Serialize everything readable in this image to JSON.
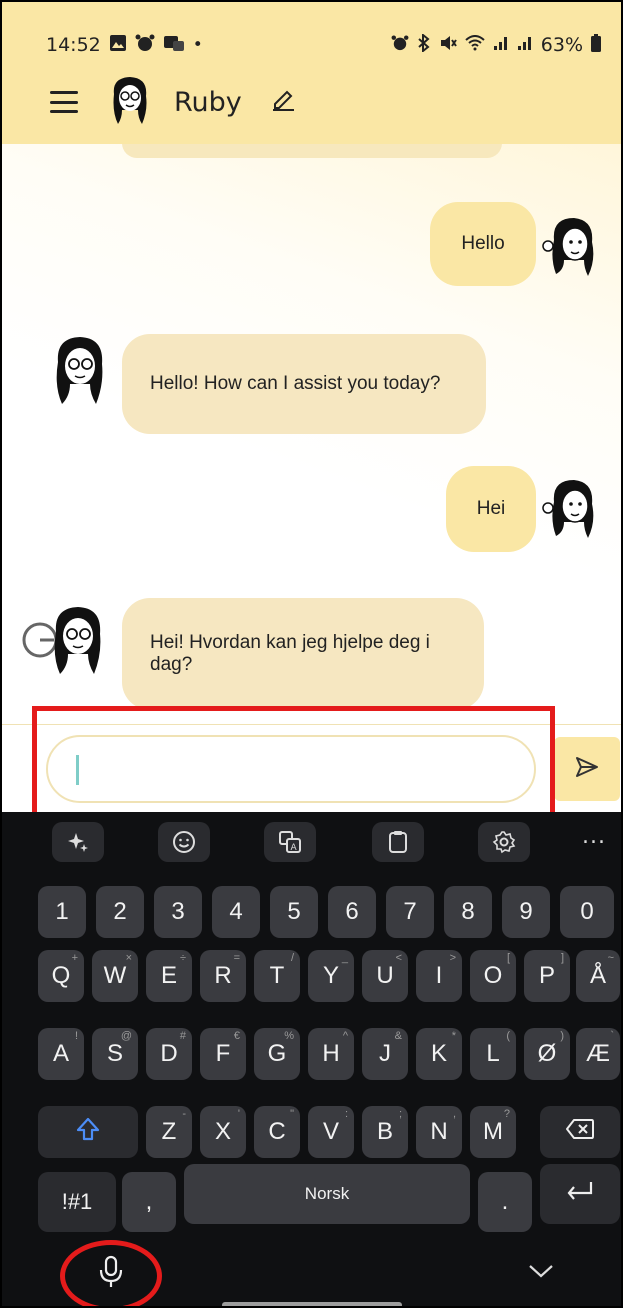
{
  "status_bar": {
    "time": "14:52",
    "left_icons": [
      "image-icon",
      "alarm-icon",
      "messenger-icon",
      "dot"
    ],
    "right_icons": [
      "alarm-icon",
      "bluetooth-icon",
      "mute-icon",
      "wifi-icon",
      "signal-icon",
      "signal-icon"
    ],
    "battery": "63%"
  },
  "header": {
    "title": "Ruby",
    "menu_icon": "hamburger-menu-icon",
    "edit_icon": "pencil-edit-icon"
  },
  "messages": [
    {
      "sender": "user",
      "text": "Hello"
    },
    {
      "sender": "bot",
      "text": "Hello! How can I assist you today?"
    },
    {
      "sender": "user",
      "text": "Hei"
    },
    {
      "sender": "bot",
      "text": "Hei! Hvordan kan jeg hjelpe deg i dag?"
    }
  ],
  "input": {
    "value": "",
    "placeholder": "",
    "send_icon": "send-icon"
  },
  "keyboard": {
    "toolbar": [
      "sparkle-icon",
      "emoji-icon",
      "translate-icon",
      "clipboard-icon",
      "settings-icon",
      "more-icon"
    ],
    "more_label": "...",
    "row_numbers": [
      "1",
      "2",
      "3",
      "4",
      "5",
      "6",
      "7",
      "8",
      "9",
      "0"
    ],
    "row1": [
      {
        "key": "Q",
        "sub": "+"
      },
      {
        "key": "W",
        "sub": "×"
      },
      {
        "key": "E",
        "sub": "÷"
      },
      {
        "key": "R",
        "sub": "="
      },
      {
        "key": "T",
        "sub": "/"
      },
      {
        "key": "Y",
        "sub": "_"
      },
      {
        "key": "U",
        "sub": "<"
      },
      {
        "key": "I",
        "sub": ">"
      },
      {
        "key": "O",
        "sub": "["
      },
      {
        "key": "P",
        "sub": "]"
      },
      {
        "key": "Å",
        "sub": "~"
      }
    ],
    "row2": [
      {
        "key": "A",
        "sub": "!"
      },
      {
        "key": "S",
        "sub": "@"
      },
      {
        "key": "D",
        "sub": "#"
      },
      {
        "key": "F",
        "sub": "€"
      },
      {
        "key": "G",
        "sub": "%"
      },
      {
        "key": "H",
        "sub": "^"
      },
      {
        "key": "J",
        "sub": "&"
      },
      {
        "key": "K",
        "sub": "*"
      },
      {
        "key": "L",
        "sub": "("
      },
      {
        "key": "Ø",
        "sub": ")"
      },
      {
        "key": "Æ",
        "sub": "`"
      }
    ],
    "row3": [
      {
        "key": "Z",
        "sub": "-"
      },
      {
        "key": "X",
        "sub": "'"
      },
      {
        "key": "C",
        "sub": "\""
      },
      {
        "key": "V",
        "sub": ":"
      },
      {
        "key": "B",
        "sub": ";"
      },
      {
        "key": "N",
        "sub": ","
      },
      {
        "key": "M",
        "sub": "?"
      }
    ],
    "symbols_label": "!#1",
    "comma_label": ",",
    "space_label": "Norsk",
    "period_label": ".",
    "shift_icon": "shift-icon",
    "backspace_icon": "backspace-icon",
    "enter_icon": "enter-icon",
    "mic_icon": "microphone-icon",
    "hide_icon": "chevron-down-icon"
  },
  "colors": {
    "header_bg": "#fae7a5",
    "user_bubble": "#fae7a5",
    "bot_bubble": "#f6e7c1",
    "keyboard_bg": "#0f1012",
    "key_bg": "#3a3b40",
    "highlight": "#e41b1b",
    "shift": "#4c8df6"
  }
}
